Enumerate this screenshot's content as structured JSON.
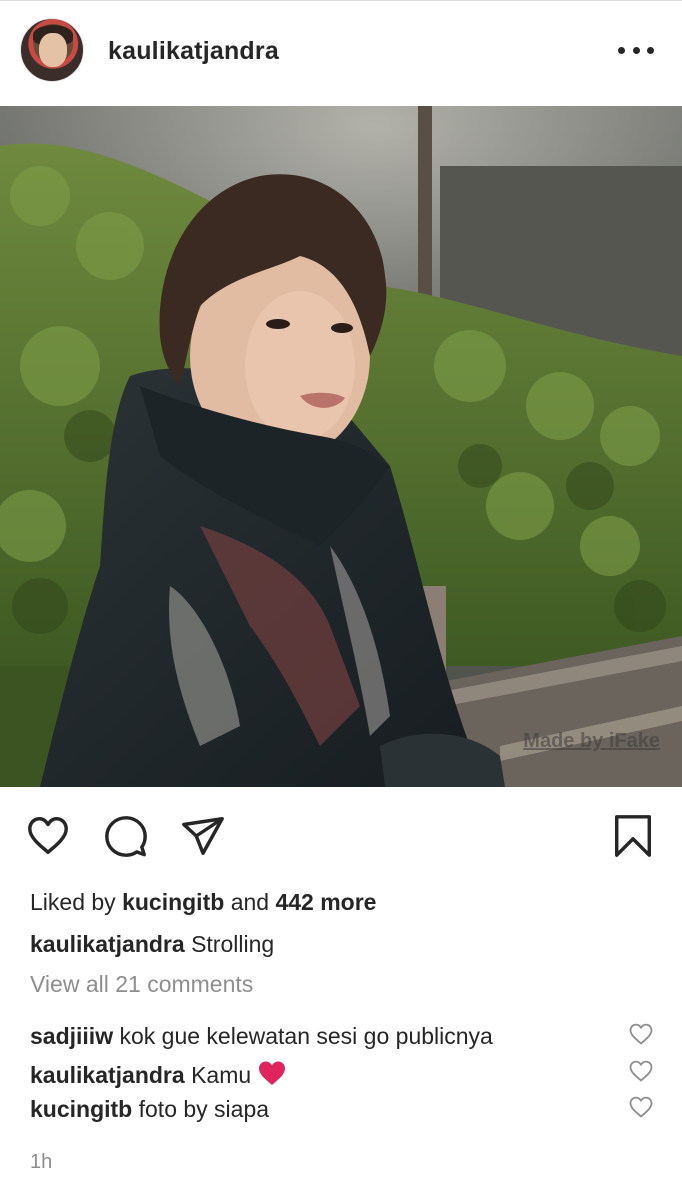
{
  "header": {
    "username": "kaulikatjandra",
    "more_icon": "more-horizontal-icon"
  },
  "photo": {
    "watermark": "Made by iFake"
  },
  "actions": {
    "like_icon": "heart-icon",
    "comment_icon": "comment-icon",
    "share_icon": "send-icon",
    "save_icon": "bookmark-icon"
  },
  "likes": {
    "prefix": "Liked by",
    "user": "kucingitb",
    "connector": "and",
    "others": "442 more"
  },
  "caption": {
    "username": "kaulikatjandra",
    "text": "Strolling"
  },
  "view_all_comments": "View all 21 comments",
  "comments": [
    {
      "username": "sadjiiiw",
      "text": "kok gue kelewatan sesi go publicnya"
    },
    {
      "username": "kaulikatjandra",
      "text": "Kamu",
      "emoji": "red-heart-emoji"
    },
    {
      "username": "kucingitb",
      "text": "foto by siapa"
    }
  ],
  "timestamp": "1h",
  "colors": {
    "text": "#262626",
    "muted": "#8e8e8e",
    "emoji_heart": "#e0245e"
  }
}
